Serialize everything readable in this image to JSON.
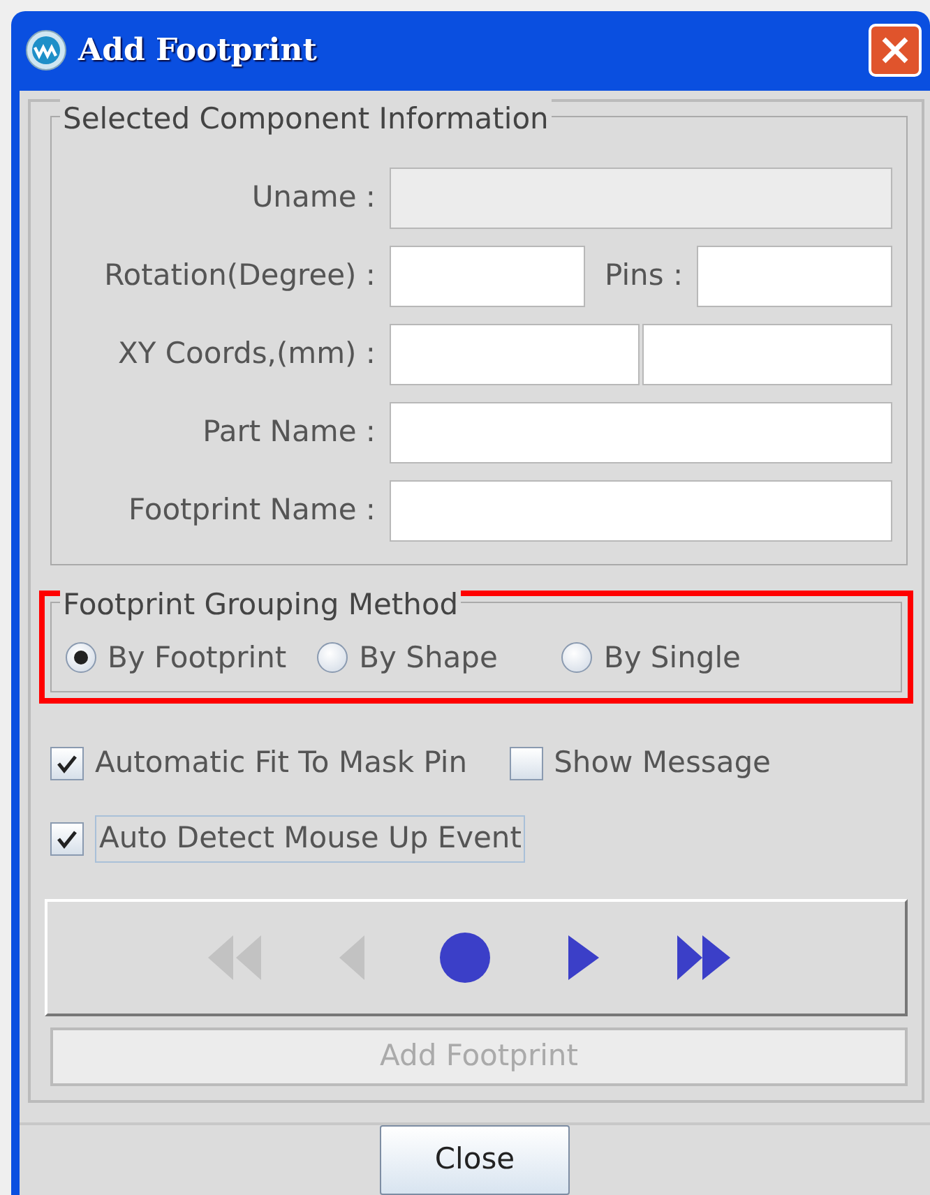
{
  "window": {
    "title": "Add Footprint"
  },
  "component_info": {
    "title": "Selected Component Information",
    "rows": [
      {
        "label": "Uname :",
        "fields": [
          {
            "disabled": true
          }
        ]
      },
      {
        "label": "Rotation(Degree) :",
        "fields": [
          {
            "disabled": false
          },
          {
            "label": "Pins :",
            "disabled": false
          }
        ]
      },
      {
        "label": "XY Coords,(mm) :",
        "fields": [
          {
            "disabled": false
          },
          {
            "disabled": false
          }
        ]
      },
      {
        "label": "Part Name :",
        "fields": [
          {
            "disabled": false
          }
        ]
      },
      {
        "label": "Footprint Name :",
        "fields": [
          {
            "disabled": false
          }
        ]
      }
    ]
  },
  "grouping": {
    "title": "Footprint Grouping Method",
    "highlighted": true,
    "options": [
      {
        "label": "By Footprint",
        "selected": true
      },
      {
        "label": "By Shape",
        "selected": false
      },
      {
        "label": "By Single",
        "selected": false
      }
    ]
  },
  "checkbox_rows": [
    [
      {
        "label": "Automatic Fit To Mask Pin",
        "checked": true,
        "focused": false
      },
      {
        "label": "Show Message",
        "checked": false,
        "focused": false
      }
    ],
    [
      {
        "label": "Auto Detect Mouse Up Event",
        "checked": true,
        "focused": true
      }
    ]
  ],
  "navigation": [
    {
      "kind": "first",
      "disabled": true
    },
    {
      "kind": "prev",
      "disabled": true
    },
    {
      "kind": "record",
      "disabled": false
    },
    {
      "kind": "next",
      "disabled": false
    },
    {
      "kind": "last",
      "disabled": false
    }
  ],
  "action_button": {
    "label": "Add Footprint",
    "disabled": true
  },
  "close_button": {
    "label": "Close"
  }
}
